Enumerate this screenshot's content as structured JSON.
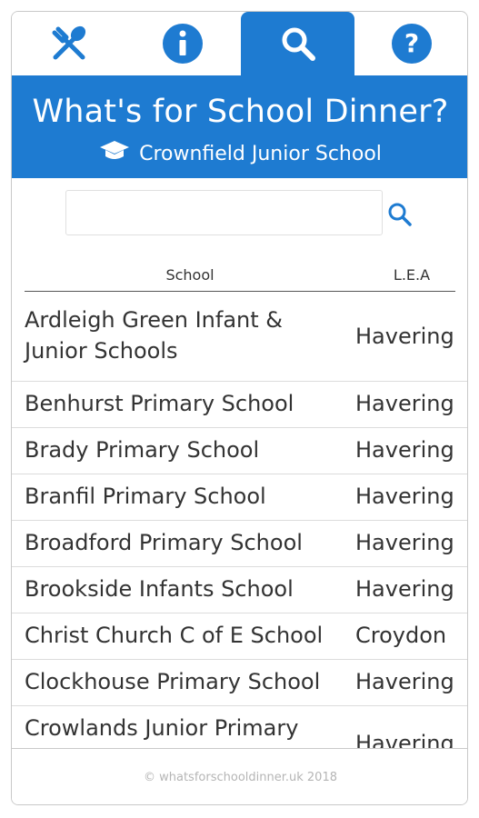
{
  "tabs": [
    {
      "icon": "cutlery-icon",
      "active": false
    },
    {
      "icon": "info-icon",
      "active": false
    },
    {
      "icon": "search-icon",
      "active": true
    },
    {
      "icon": "help-icon",
      "active": false
    }
  ],
  "header": {
    "title": "What's for School Dinner?",
    "school_icon": "graduation-cap-icon",
    "school_name": "Crownfield Junior School"
  },
  "search": {
    "value": "",
    "placeholder": "",
    "button_icon": "search-icon"
  },
  "table": {
    "columns": [
      "School",
      "L.E.A"
    ],
    "rows": [
      {
        "school": "Ardleigh Green Infant & Junior Schools",
        "lea": "Havering"
      },
      {
        "school": "Benhurst Primary School",
        "lea": "Havering"
      },
      {
        "school": "Brady Primary School",
        "lea": "Havering"
      },
      {
        "school": "Branfil Primary School",
        "lea": "Havering"
      },
      {
        "school": "Broadford Primary School",
        "lea": "Havering"
      },
      {
        "school": "Brookside Infants School",
        "lea": "Havering"
      },
      {
        "school": "Christ Church C of E School",
        "lea": "Croydon"
      },
      {
        "school": "Clockhouse Primary School",
        "lea": "Havering"
      },
      {
        "school": "Crowlands Junior Primary",
        "lea": "Havering"
      }
    ]
  },
  "footer": {
    "copyright": "© whatsforschooldinner.uk 2018"
  },
  "colors": {
    "brand_blue": "#1e7bd1",
    "text": "#333333",
    "footer_text": "#b5b5b5"
  }
}
